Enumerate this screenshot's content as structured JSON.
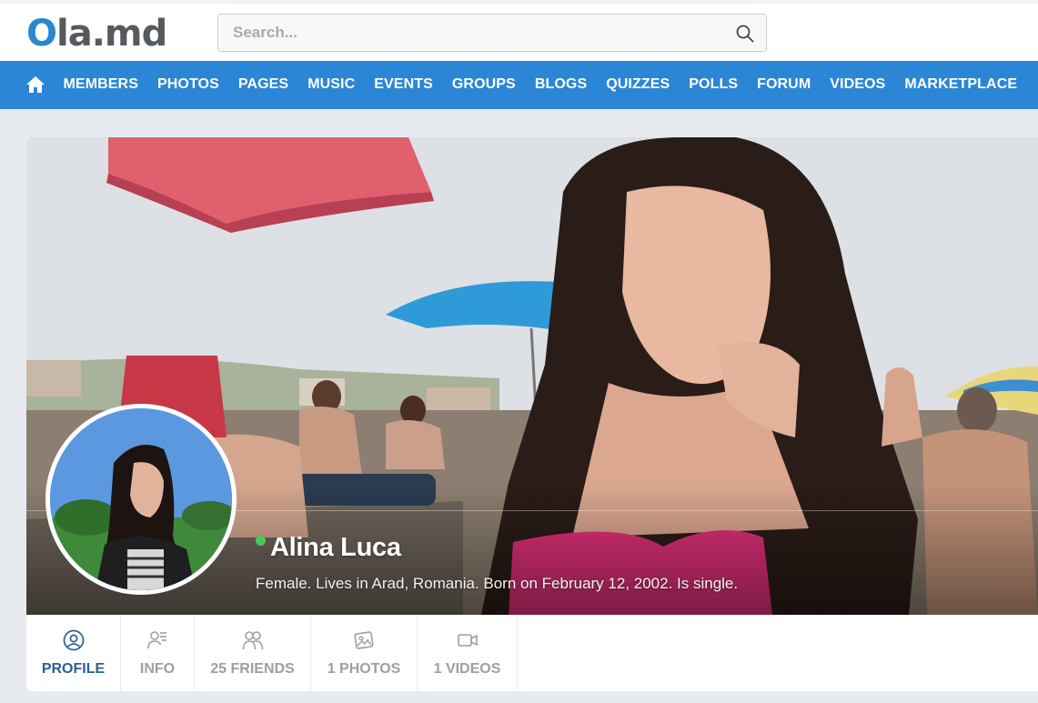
{
  "header": {
    "logo_o": "O",
    "logo_rest": "la.md",
    "search_placeholder": "Search..."
  },
  "nav": {
    "items": [
      "MEMBERS",
      "PHOTOS",
      "PAGES",
      "MUSIC",
      "EVENTS",
      "GROUPS",
      "BLOGS",
      "QUIZZES",
      "POLLS",
      "FORUM",
      "VIDEOS",
      "MARKETPLACE"
    ]
  },
  "profile": {
    "name": "Alina Luca",
    "bio": "Female. Lives in Arad, Romania. Born on February 12, 2002. Is single.",
    "online": true
  },
  "tabs": [
    {
      "label": "PROFILE",
      "icon": "user-circle-icon",
      "active": true
    },
    {
      "label": "INFO",
      "icon": "user-info-icon",
      "active": false
    },
    {
      "label": "25 FRIENDS",
      "icon": "friends-icon",
      "active": false
    },
    {
      "label": "1 PHOTOS",
      "icon": "photos-icon",
      "active": false
    },
    {
      "label": "1 VIDEOS",
      "icon": "video-camera-icon",
      "active": false
    }
  ],
  "colors": {
    "brand_blue": "#2b86d6",
    "logo_gray": "#555a5f",
    "active_tab": "#2a5f93",
    "online": "#44cc55"
  }
}
